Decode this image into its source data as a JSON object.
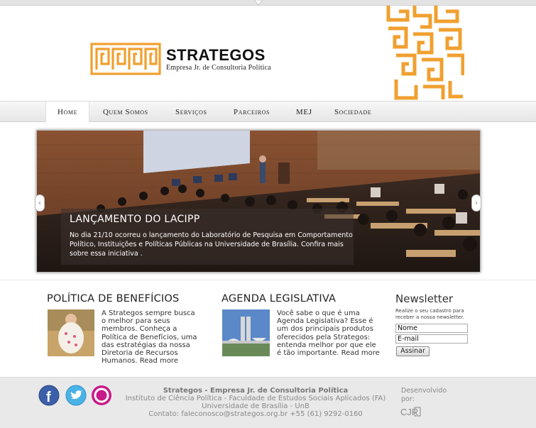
{
  "header": {
    "brand_name": "STRATEGOS",
    "brand_tagline": "Empresa Jr. de Consultoria Política",
    "brand_color": "#f0a030"
  },
  "nav": {
    "items": [
      {
        "label": "Home",
        "active": true
      },
      {
        "label": "Quem Somos"
      },
      {
        "label": "Serviços"
      },
      {
        "label": "Parceiros"
      },
      {
        "label": "MEJ"
      },
      {
        "label": "Sociedade"
      }
    ]
  },
  "slider": {
    "title": "LANÇAMENTO DO LACIPP",
    "text": " No dia 21/10 ocorreu o lançamento do  Laboratório de Pesquisa em Comportamento Político, Instituições e Políticas Públicas na Universidade de Brasília. Confira mais sobre essa iniciativa .",
    "prev_icon": "chevron-left-icon",
    "next_icon": "chevron-right-icon"
  },
  "columns": {
    "beneficios": {
      "title": "POLÍTICA DE BENEFÍCIOS",
      "text": "A Strategos sempre busca o melhor para seus membros. Conheça a Política de Benefícios, uma das estratégias da nossa Diretoria de Recursos Humanos.",
      "read_more": "Read more"
    },
    "agenda": {
      "title": "AGENDA LEGISLATIVA",
      "text": "Você sabe o que é uma Agenda Legislativa? Esse é um dos principais produtos oferecidos pela Strategos: entenda melhor por que ele é tão importante.",
      "read_more": "Read more"
    }
  },
  "newsletter": {
    "title": "Newsletter",
    "description": "Realize o seu cadastro para receber a nossa newsletter.",
    "name_value": "Nome",
    "email_value": "E-mail",
    "button_label": "Assinar"
  },
  "footer": {
    "company": "Strategos - Empresa Jr. de Consultoria Política",
    "institute": "Instituto de Ciência Política - Faculdade de Estudos Sociais Aplicados (FA)",
    "university": "Universidade de Brasília - UnB",
    "contact": "Contato: faleconosco@strategos.org.br +55 (61) 9292-0160",
    "developed_by": "Desenvolvido por:",
    "dev_logo_text": "CJR",
    "social": [
      "facebook-icon",
      "twitter-icon",
      "orkut-icon"
    ]
  }
}
